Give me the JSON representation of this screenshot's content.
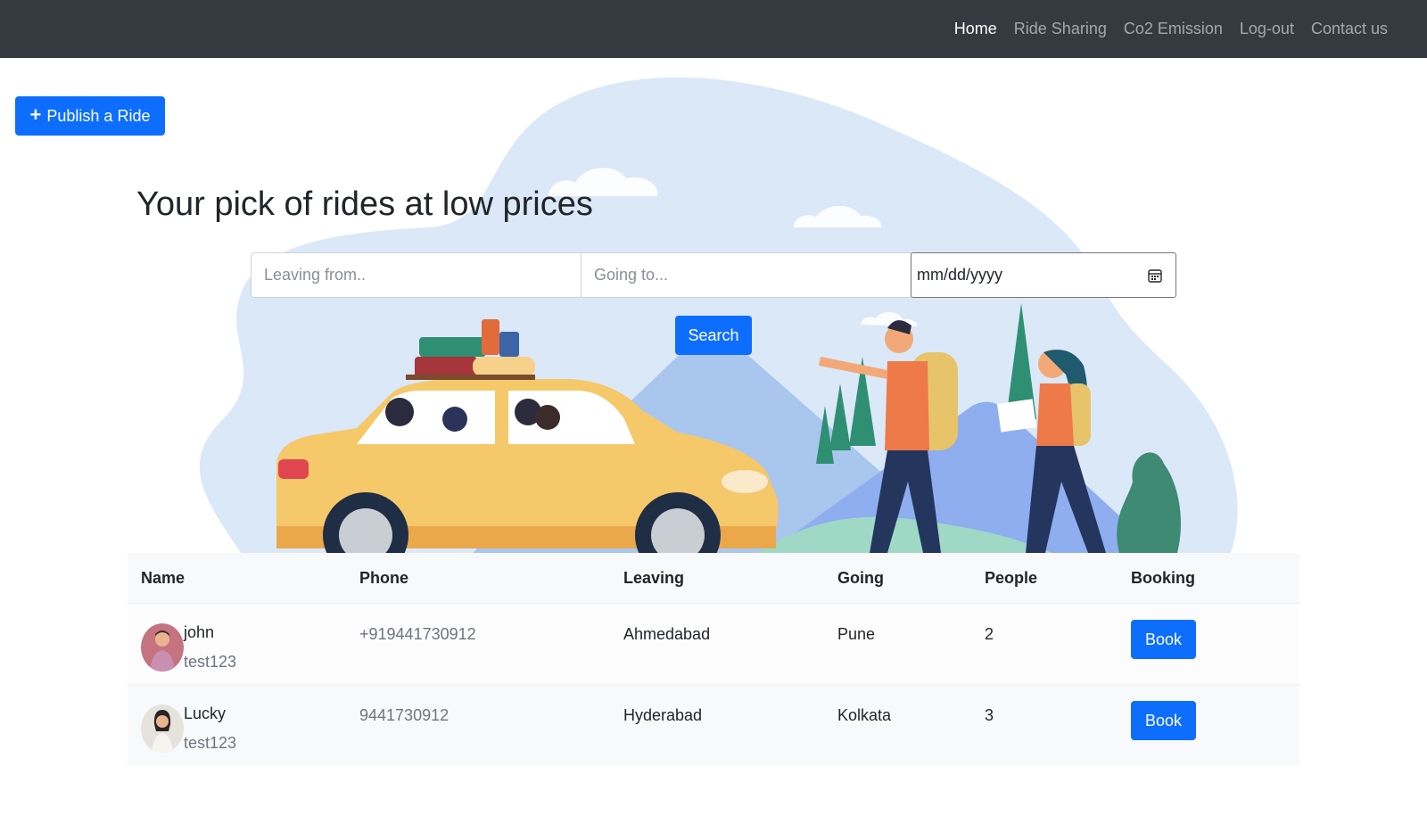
{
  "navbar": {
    "links": [
      {
        "label": "Home",
        "active": true
      },
      {
        "label": "Ride Sharing",
        "active": false
      },
      {
        "label": "Co2 Emission",
        "active": false
      },
      {
        "label": "Log-out",
        "active": false
      },
      {
        "label": "Contact us",
        "active": false
      }
    ],
    "background": "#343a40"
  },
  "publish": {
    "label": "Publish a Ride",
    "icon": "plus-icon"
  },
  "hero": {
    "title": "Your pick of rides at low prices"
  },
  "search": {
    "leaving_placeholder": "Leaving from..",
    "going_placeholder": "Going to...",
    "date_value": "mm/dd/yyyy",
    "button_label": "Search"
  },
  "table": {
    "headers": [
      "Name",
      "Phone",
      "Leaving",
      "Going",
      "People",
      "Booking"
    ],
    "rows": [
      {
        "name": "john",
        "username": "test123",
        "phone": "+919441730912",
        "leaving": "Ahmedabad",
        "going": "Pune",
        "people": "2",
        "book_label": "Book"
      },
      {
        "name": "Lucky",
        "username": "test123",
        "phone": "9441730912",
        "leaving": "Hyderabad",
        "going": "Kolkata",
        "people": "3",
        "book_label": "Book"
      }
    ]
  },
  "colors": {
    "primary": "#0d6efd",
    "hero_blob": "#dbe8f8",
    "car": "#f5c86a"
  }
}
